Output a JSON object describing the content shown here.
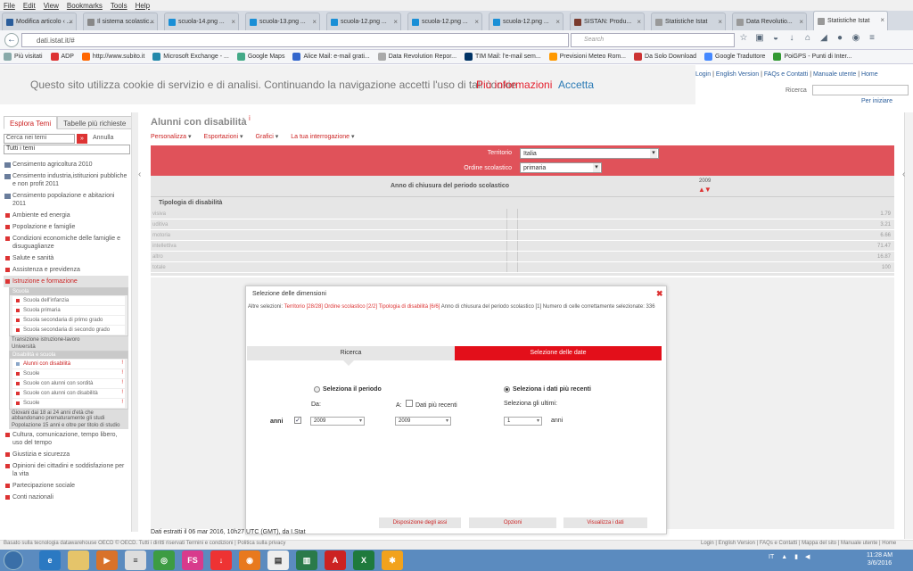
{
  "menubar": [
    "File",
    "Edit",
    "View",
    "Bookmarks",
    "Tools",
    "Help"
  ],
  "tabs": [
    {
      "label": "Modifica articolo ‹ ...",
      "color": "#2a5d9b"
    },
    {
      "label": "Il sistema scolastic...",
      "color": "#888"
    },
    {
      "label": "scuola-14.png ...",
      "color": "#1a8fd6"
    },
    {
      "label": "scuola-13.png ...",
      "color": "#1a8fd6"
    },
    {
      "label": "scuola-12.png ...",
      "color": "#1a8fd6"
    },
    {
      "label": "scuola-12.png ...",
      "color": "#1a8fd6"
    },
    {
      "label": "scuola-12.png ...",
      "color": "#1a8fd6"
    },
    {
      "label": "SISTAN: Produ...",
      "color": "#7a3b2e"
    },
    {
      "label": "Statistiche Istat",
      "color": "#999"
    },
    {
      "label": "Data Revolutio...",
      "color": "#999"
    },
    {
      "label": "Statistiche Istat",
      "color": "#999"
    }
  ],
  "nav": {
    "back": "←",
    "url": "dati.istat.it/#",
    "search_placeholder": "Search"
  },
  "bookmarks": [
    {
      "label": "Più visitati",
      "color": "#8aa"
    },
    {
      "label": "ADP",
      "color": "#d33"
    },
    {
      "label": "http://www.subito.it",
      "color": "#f60"
    },
    {
      "label": "Microsoft Exchange - ...",
      "color": "#28a"
    },
    {
      "label": "Google Maps",
      "color": "#4a8"
    },
    {
      "label": "Alice Mail: e-mail grati...",
      "color": "#36c"
    },
    {
      "label": "Data Revolution Repor...",
      "color": "#aaa"
    },
    {
      "label": "TIM Mail: l'e-mail sem...",
      "color": "#036"
    },
    {
      "label": "Previsioni Meteo Rom...",
      "color": "#f90"
    },
    {
      "label": "Da Solo Download",
      "color": "#c33"
    },
    {
      "label": "Google Traduttore",
      "color": "#48f"
    },
    {
      "label": "PoiGPS - Punti di Inter...",
      "color": "#393"
    }
  ],
  "cookie": {
    "text": "Questo sito utilizza cookie di servizio e di analisi. Continuando la navigazione accetti l'uso di tali cookie",
    "more": "Più informazioni",
    "accept": "Accetta"
  },
  "toplinks": {
    "login": "Login",
    "sep1": " | ",
    "english": "English Version",
    "sep2": " | ",
    "faq": "FAQs e Contatti",
    "sep3": " | ",
    "manual": "Manuale utente",
    "sep4": " | ",
    "home": "Home"
  },
  "site_search": {
    "label": "Ricerca",
    "start": "Per iniziare"
  },
  "sidebar": {
    "tabs": [
      "Esplora Temi",
      "Tabelle più richieste"
    ],
    "search_value": "Cerca nei temi",
    "go": "»",
    "annulla": "Annulla",
    "filter": "Tutti i temi",
    "census": [
      "Censimento agricoltura 2010",
      "Censimento industria,istituzioni pubbliche e non profit 2011",
      "Censimento popolazione e abitazioni 2011"
    ],
    "themes_top": [
      "Ambiente ed energia",
      "Popolazione e famiglie",
      "Condizioni economiche delle famiglie e disuguaglianze",
      "Salute e sanità",
      "Assistenza e previdenza"
    ],
    "open_theme": "Istruzione e formazione",
    "scuola_h": "Scuola",
    "scuola": [
      "Scuola dell'infanzia",
      "Scuola primaria",
      "Scuola secondaria di primo grado",
      "Scuola secondaria di secondo grado"
    ],
    "transizione": "Transizione istruzione-lavoro",
    "universita": "Università",
    "disab_h": "Disabilità e scuola",
    "disab": [
      "Alunni con disabilità",
      "Scuole",
      "Scuole con alunni con sordità",
      "Scuole con alunni con disabilità",
      "Scuole"
    ],
    "giovani": "Giovani dai 18 ai 24 anni d'età che abbandonano prematuramente gli studi",
    "popolazione15": "Popolazione 15 anni e oltre per titolo di studio",
    "themes_bottom": [
      "Cultura, comunicazione, tempo libero, uso del tempo",
      "Giustizia e sicurezza",
      "Opinioni dei cittadini e soddisfazione per la vita",
      "Partecipazione sociale",
      "Conti nazionali"
    ]
  },
  "main": {
    "title": "Alunni con disabilità",
    "title_mark": "i",
    "toolbar": [
      "Personalizza",
      "Esportazioni",
      "Grafici",
      "La tua interrogazione"
    ],
    "territorio_lbl": "Territorio",
    "territorio_val": "Italia",
    "ordine_lbl": "Ordine scolastico",
    "ordine_val": "primaria",
    "anno_lbl": "Anno di chiusura del periodo scolastico",
    "year": "2009",
    "sort": "▲▼",
    "tipologia_lbl": "Tipologia di disabilità",
    "rows": [
      {
        "label": "visiva",
        "value": "1.79"
      },
      {
        "label": "uditiva",
        "value": "3.21"
      },
      {
        "label": "motoria",
        "value": "6.66"
      },
      {
        "label": "intellettiva",
        "value": "71.47"
      },
      {
        "label": "altro",
        "value": "16.87"
      },
      {
        "label": "totale",
        "value": "100"
      }
    ],
    "estratti": "Dati estratti il 06 mar 2016, 10h27 UTC (GMT), da I.Stat"
  },
  "dialog": {
    "title": "Selezione delle dimensioni",
    "close": "✖",
    "altre": "Altre selezioni:",
    "sel1": "Territorio [28/28]",
    "sel2": "Ordine scolastico [2/2]",
    "sel3": "Tipologia di disabilità [6/6]",
    "rest": "Anno di chiusura del periodo scolastico [1]  Numero di celle correttamente selezionate: 336",
    "tab_ricerca": "Ricerca",
    "tab_sel": "Selezione delle date",
    "periodo": "Seleziona il periodo",
    "recenti": "Seleziona i dati più recenti",
    "da": "Da:",
    "a": "A:",
    "dati_recenti": "Dati più recenti",
    "ultimi": "Seleziona gli ultimi:",
    "anni": "anni",
    "from": "2009",
    "to": "2009",
    "n": "1",
    "anni2": "anni",
    "btn1": "Disposizione degli assi",
    "btn2": "Opzioni",
    "btn3": "Visualizza i dati"
  },
  "footer": {
    "left": "Basato sulla tecnologia datawarehouse OECD © OECD. Tutti i diritti riservati Termini e condizioni  |  Politica sulla privacy",
    "right": "Login | English Version | FAQs e Contatti | Mappa del sito | Manuale utente | Home"
  },
  "taskbar": {
    "lang": "IT",
    "time": "11:28 AM",
    "date": "3/6/2016"
  }
}
